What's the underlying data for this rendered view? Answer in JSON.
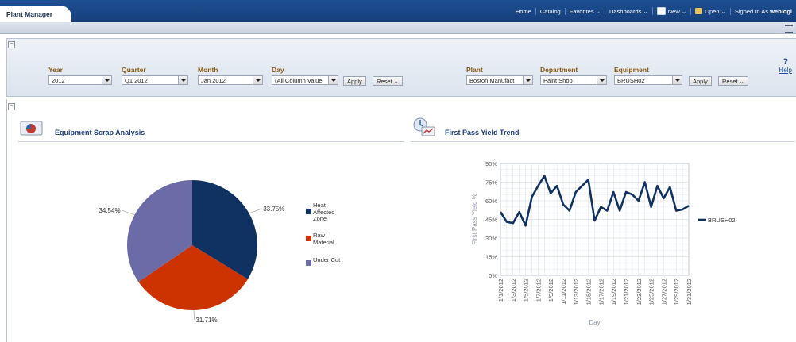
{
  "app": {
    "tab_title": "Plant Manager"
  },
  "nav": {
    "home": "Home",
    "catalog": "Catalog",
    "favorites": "Favorites ⌄",
    "dashboards": "Dashboards ⌄",
    "new": "New ⌄",
    "open": "Open ⌄",
    "signed_in_prefix": "Signed In As",
    "user": "weblogi"
  },
  "prompts_left": {
    "year": {
      "label": "Year",
      "value": "2012"
    },
    "quarter": {
      "label": "Quarter",
      "value": "Q1 2012"
    },
    "month": {
      "label": "Month",
      "value": "Jan 2012"
    },
    "day": {
      "label": "Day",
      "value": "(All Column Value"
    },
    "apply": "Apply",
    "reset": "Reset ⌄"
  },
  "prompts_right": {
    "plant": {
      "label": "Plant",
      "value": "Boston Manufact"
    },
    "department": {
      "label": "Department",
      "value": "Paint Shop"
    },
    "equipment": {
      "label": "Equipment",
      "value": "BRUSH02"
    },
    "apply": "Apply",
    "reset": "Reset ⌄"
  },
  "help": {
    "q": "?",
    "label": "Help"
  },
  "colors": {
    "navy": "#0f3262",
    "red": "#cc3300",
    "purple": "#6b6ba8",
    "line": "#0f3262"
  },
  "scrap": {
    "title": "Equipment Scrap Analysis",
    "chart_data": {
      "type": "pie",
      "slices": [
        {
          "label": "Heat Affected Zone",
          "value": 33.75,
          "pct_label": "33.75%"
        },
        {
          "label": "Raw Material",
          "value": 31.71,
          "pct_label": "31.71%"
        },
        {
          "label": "Under Cut",
          "value": 34.54,
          "pct_label": "34.54%"
        }
      ],
      "legend": [
        "Heat Affected Zone",
        "Raw Material",
        "Under Cut"
      ]
    }
  },
  "fpy": {
    "title": "First Pass Yield Trend",
    "chart_data": {
      "type": "line",
      "ylabel": "First Pass Yield %",
      "xlabel": "Day",
      "ylim": [
        0,
        90
      ],
      "yticks": [
        "90%",
        "75%",
        "60%",
        "45%",
        "30%",
        "15%",
        "0%"
      ],
      "xtick_labels": [
        "1/1/2012",
        "1/3/2012",
        "1/5/2012",
        "1/7/2012",
        "1/9/2012",
        "1/11/2012",
        "1/13/2012",
        "1/15/2012",
        "1/17/2012",
        "1/19/2012",
        "1/21/2012",
        "1/23/2012",
        "1/25/2012",
        "1/27/2012",
        "1/29/2012",
        "1/31/2012"
      ],
      "series": [
        {
          "name": "BRUSH02",
          "values": [
            51,
            43,
            42,
            51,
            40,
            63,
            72,
            80,
            66,
            72,
            57,
            52,
            67,
            72,
            77,
            44,
            55,
            52,
            67,
            52,
            67,
            65,
            60,
            75,
            55,
            72,
            62,
            71,
            52,
            53,
            56
          ]
        }
      ]
    }
  }
}
